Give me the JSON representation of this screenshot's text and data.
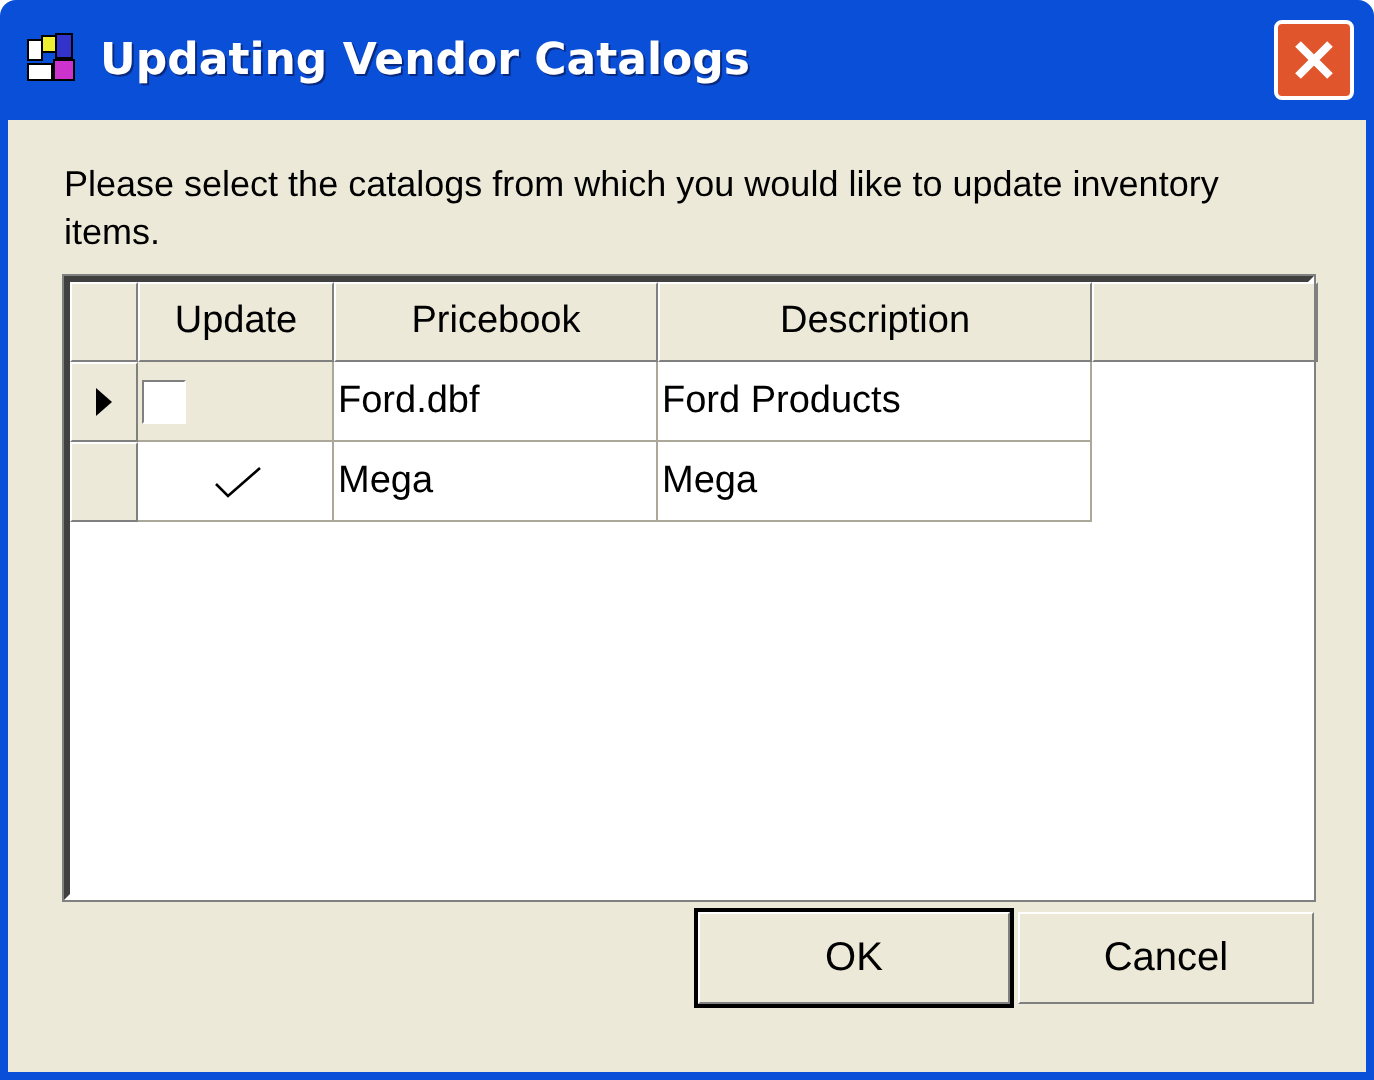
{
  "window": {
    "title": "Updating Vendor Catalogs"
  },
  "instructions": "Please select the catalogs from which you would like to update inventory items.",
  "table": {
    "columns": [
      "Update",
      "Pricebook",
      "Description"
    ],
    "rows": [
      {
        "selected": true,
        "checked": false,
        "pricebook": "Ford.dbf",
        "description": "Ford Products"
      },
      {
        "selected": false,
        "checked": true,
        "pricebook": "Mega",
        "description": "Mega"
      }
    ]
  },
  "buttons": [
    {
      "label": "OK",
      "default": true
    },
    {
      "label": "Cancel",
      "default": false
    }
  ]
}
